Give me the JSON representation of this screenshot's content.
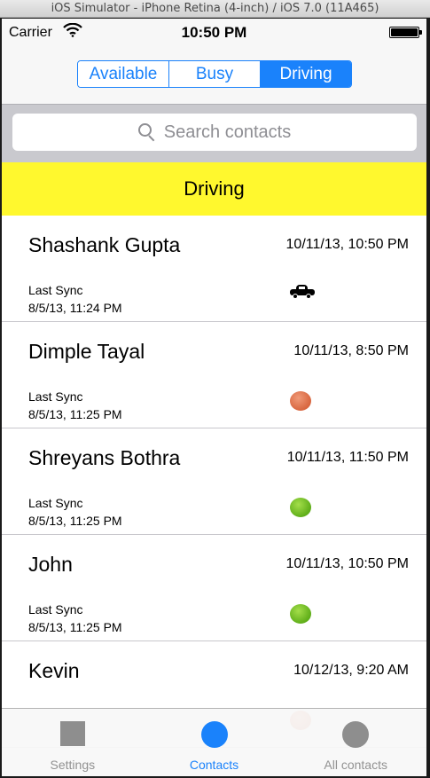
{
  "simulator": {
    "title": "iOS Simulator - iPhone Retina (4-inch) / iOS 7.0 (11A465)"
  },
  "status_bar": {
    "carrier": "Carrier",
    "time": "10:50 PM"
  },
  "segments": [
    {
      "label": "Available",
      "selected": false
    },
    {
      "label": "Busy",
      "selected": false
    },
    {
      "label": "Driving",
      "selected": true
    }
  ],
  "search": {
    "placeholder": "Search contacts"
  },
  "section": {
    "title": "Driving"
  },
  "contacts": [
    {
      "name": "Shashank Gupta",
      "time": "10/11/13, 10:50 PM",
      "sync_label": "Last Sync",
      "sync_date": "8/5/13, 11:24 PM",
      "status_icon": "car-icon"
    },
    {
      "name": "Dimple Tayal",
      "time": "10/11/13, 8:50 PM",
      "sync_label": "Last Sync",
      "sync_date": "8/5/13, 11:25 PM",
      "status_icon": "orange-dot-icon"
    },
    {
      "name": "Shreyans Bothra",
      "time": "10/11/13, 11:50 PM",
      "sync_label": "Last Sync",
      "sync_date": "8/5/13, 11:25 PM",
      "status_icon": "green-dot-icon"
    },
    {
      "name": "John",
      "time": "10/11/13, 10:50 PM",
      "sync_label": "Last Sync",
      "sync_date": "8/5/13, 11:25 PM",
      "status_icon": "green-dot-icon"
    },
    {
      "name": "Kevin",
      "time": "10/12/13, 9:20 AM",
      "sync_label": "",
      "sync_date": "",
      "status_icon": "orange-dot-icon"
    }
  ],
  "tabs": [
    {
      "label": "Settings",
      "icon": "square-icon",
      "active": false
    },
    {
      "label": "Contacts",
      "icon": "circle-icon",
      "active": true
    },
    {
      "label": "All contacts",
      "icon": "circle-icon",
      "active": false
    }
  ],
  "colors": {
    "accent": "#1a82fb",
    "section_header_bg": "#fff82e",
    "status_orange": "#d8663f",
    "status_green": "#5fae19"
  }
}
